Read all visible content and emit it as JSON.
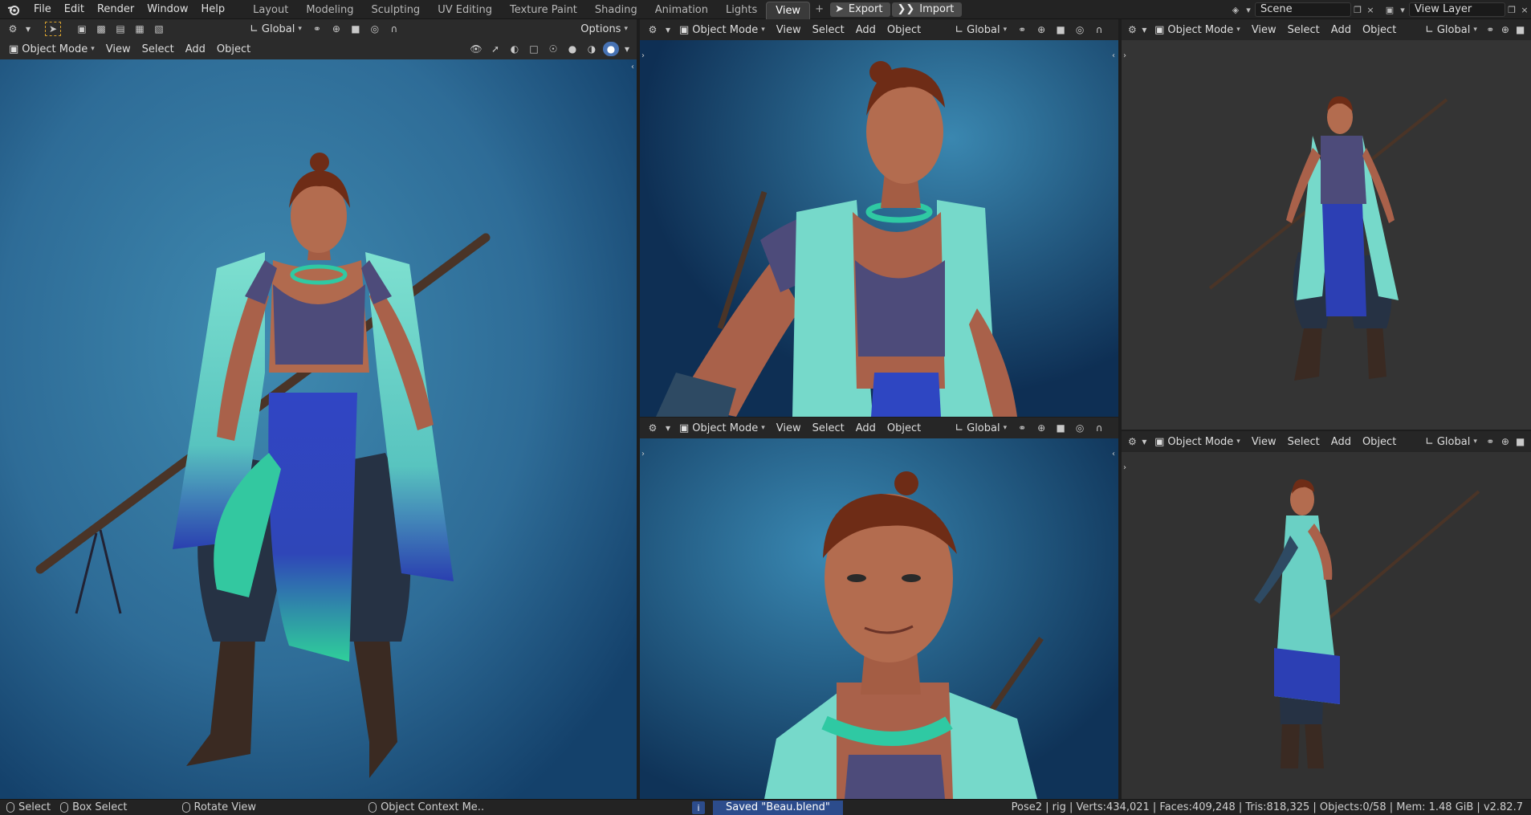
{
  "app": {
    "menus": [
      "File",
      "Edit",
      "Render",
      "Window",
      "Help"
    ],
    "workspaces": [
      "Layout",
      "Modeling",
      "Sculpting",
      "UV Editing",
      "Texture Paint",
      "Shading",
      "Animation",
      "Lights",
      "View"
    ],
    "active_workspace": "View",
    "addon_buttons": [
      "Export",
      "Import"
    ],
    "scene": "Scene",
    "view_layer": "View Layer"
  },
  "viewport": {
    "mode": "Object Mode",
    "menus": [
      "View",
      "Select",
      "Add",
      "Object"
    ],
    "orientation": "Global",
    "options": "Options"
  },
  "status": {
    "select": "Select",
    "box_select": "Box Select",
    "rotate": "Rotate View",
    "context": "Object Context Me..",
    "saved": "Saved \"Beau.blend\"",
    "stats": "Pose2 | rig | Verts:434,021 | Faces:409,248 | Tris:818,325 | Objects:0/58 | Mem: 1.48 GiB | v2.82.7"
  },
  "colors": {
    "bg_blue_light": "#3b86ad",
    "bg_blue_dark": "#0d2f52",
    "bg_grey": "#353535",
    "vest": "#6fd7c7",
    "pants": "#2c3fb4",
    "skin": "#b4674a",
    "hair": "#6e2c16"
  }
}
